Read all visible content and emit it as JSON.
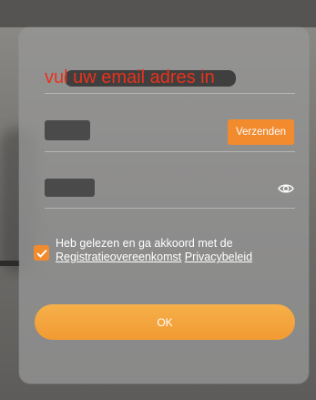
{
  "form": {
    "email_placeholder": "vul uw email adres in",
    "send_label": "Verzenden",
    "agree_text": "Heb gelezen en ga akkoord met de",
    "link_registration": "Registratieovereenkomst",
    "link_privacy": "Privacybeleid",
    "ok_label": "OK",
    "checkbox_checked": true,
    "accent_color": "#f28a2e",
    "error_color": "#e8321c"
  }
}
